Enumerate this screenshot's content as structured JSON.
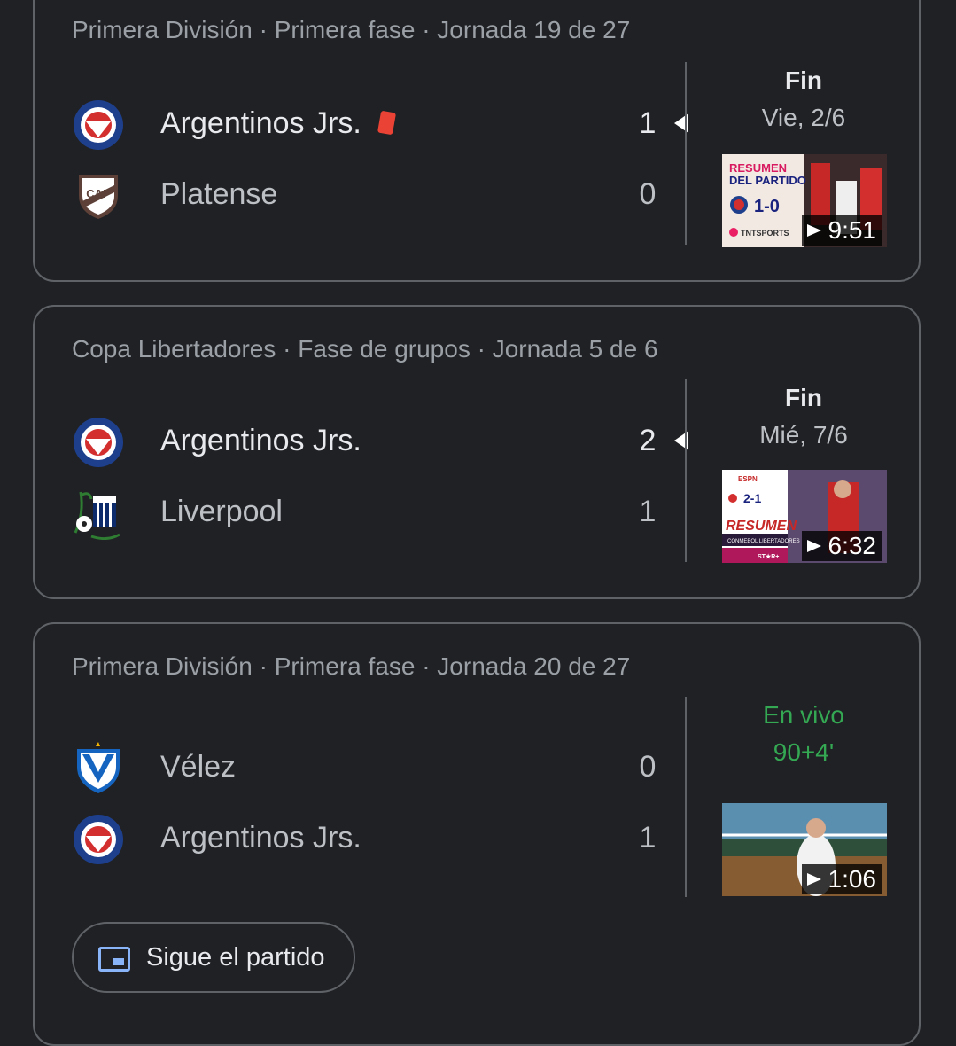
{
  "matches": [
    {
      "header": "Primera División · Primera fase · Jornada 19 de 27",
      "home": {
        "name": "Argentinos Jrs.",
        "score": "1",
        "crest": "argentinos-crest",
        "red_card": true
      },
      "away": {
        "name": "Platense",
        "score": "0",
        "crest": "platense-crest"
      },
      "status": "Fin",
      "date": "Vie, 2/6",
      "video": {
        "duration": "9:51",
        "thumb_text_1": "RESUMEN",
        "thumb_text_2": "DEL PARTIDO",
        "thumb_score": "1-0",
        "thumb_brand": "TNTSPORTS"
      }
    },
    {
      "header": "Copa Libertadores · Fase de grupos · Jornada 5 de 6",
      "home": {
        "name": "Argentinos Jrs.",
        "score": "2",
        "crest": "argentinos-crest"
      },
      "away": {
        "name": "Liverpool",
        "score": "1",
        "crest": "liverpool-crest"
      },
      "status": "Fin",
      "date": "Mié, 7/6",
      "video": {
        "duration": "6:32",
        "thumb_text_1": "RESUMEN",
        "thumb_score": "2-1",
        "thumb_brand": "ESPN",
        "thumb_sub": "CONMEBOL LIBERTADORES",
        "thumb_star": "ST★R+"
      }
    },
    {
      "header": "Primera División · Primera fase · Jornada 20 de 27",
      "home": {
        "name": "Vélez",
        "score": "0",
        "crest": "velez-crest"
      },
      "away": {
        "name": "Argentinos Jrs.",
        "score": "1",
        "crest": "argentinos-crest"
      },
      "status": "En vivo",
      "minute": "90+4'",
      "video": {
        "duration": "1:06"
      },
      "follow_label": "Sigue el partido"
    }
  ],
  "colors": {
    "background": "#202124",
    "border": "#5f6368",
    "live": "#34a853",
    "accent": "#8ab4f8",
    "red_card": "#ea4335"
  }
}
